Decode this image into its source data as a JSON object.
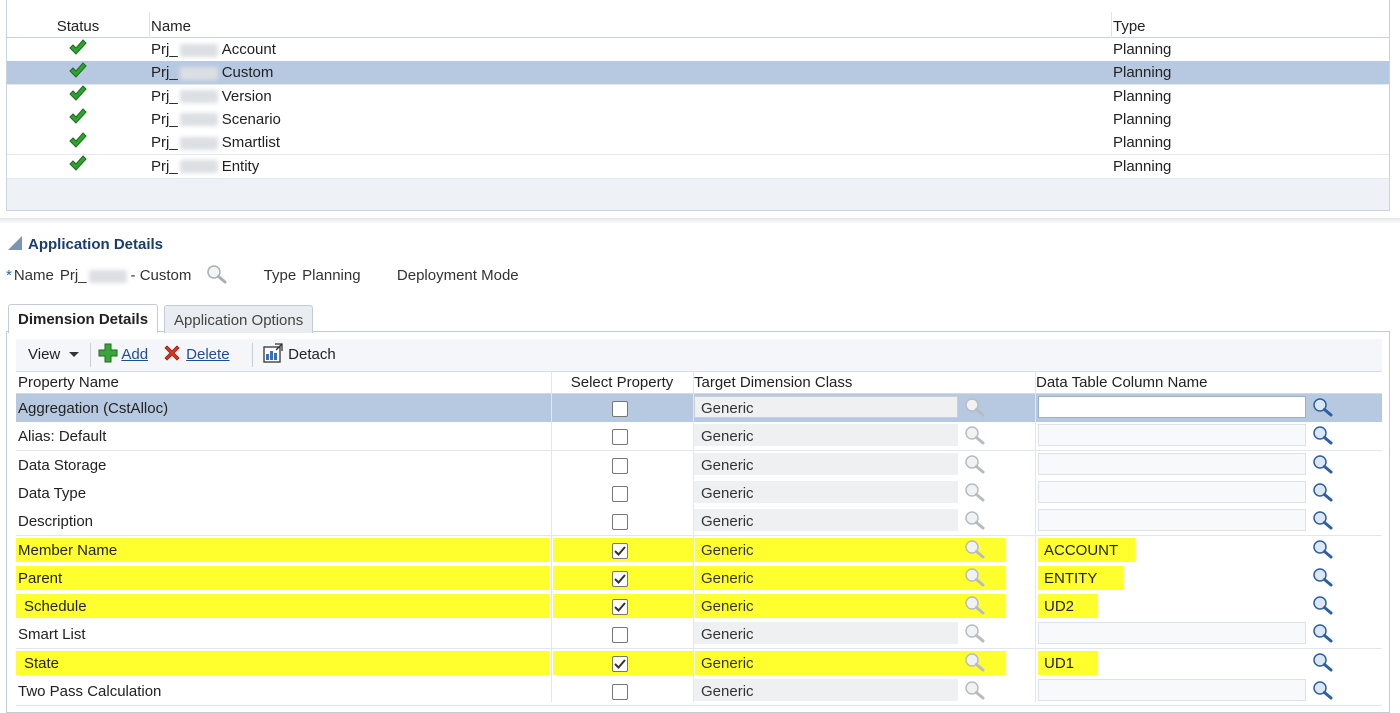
{
  "top_table": {
    "columns": [
      "Status",
      "Name",
      "Type"
    ],
    "rows": [
      {
        "prefix": "Prj_",
        "suffix": "Account",
        "type": "Planning",
        "selected": false
      },
      {
        "prefix": "Prj_",
        "suffix": "Custom",
        "type": "Planning",
        "selected": true
      },
      {
        "prefix": "Prj_",
        "suffix": "Version",
        "type": "Planning",
        "selected": false
      },
      {
        "prefix": "Prj_",
        "suffix": "Scenario",
        "type": "Planning",
        "selected": false
      },
      {
        "prefix": "Prj_",
        "suffix": "Smartlist",
        "type": "Planning",
        "selected": false
      },
      {
        "prefix": "Prj_",
        "suffix": "Entity",
        "type": "Planning",
        "selected": false
      }
    ]
  },
  "app_details": {
    "title": "Application Details",
    "required_mark": "*",
    "name_label": "Name",
    "name_prefix": "Prj_",
    "name_suffix": "- Custom",
    "type_label": "Type",
    "type_value": "Planning",
    "deployment_label": "Deployment Mode"
  },
  "tabs": [
    {
      "label": "Dimension Details",
      "active": true
    },
    {
      "label": "Application Options",
      "active": false
    }
  ],
  "toolbar": {
    "view_label": "View",
    "add_label": "Add",
    "delete_label": "Delete",
    "detach_label": "Detach"
  },
  "grid": {
    "columns": [
      "Property Name",
      "Select Property",
      "Target Dimension Class",
      "Data Table Column Name"
    ],
    "rows": [
      {
        "property": "Aggregation (CstAlloc)",
        "checked": false,
        "target": "Generic",
        "column": "",
        "selected": true,
        "highlight": false
      },
      {
        "property": "Alias: Default",
        "checked": false,
        "target": "Generic",
        "column": "",
        "selected": false,
        "highlight": false
      },
      {
        "property": "Data Storage",
        "checked": false,
        "target": "Generic",
        "column": "",
        "selected": false,
        "highlight": false
      },
      {
        "property": "Data Type",
        "checked": false,
        "target": "Generic",
        "column": "",
        "selected": false,
        "highlight": false
      },
      {
        "property": "Description",
        "checked": false,
        "target": "Generic",
        "column": "",
        "selected": false,
        "highlight": false
      },
      {
        "property": "Member Name",
        "checked": true,
        "target": "Generic",
        "column": "ACCOUNT",
        "selected": false,
        "highlight": true
      },
      {
        "property": "Parent",
        "checked": true,
        "target": "Generic",
        "column": "ENTITY",
        "selected": false,
        "highlight": true
      },
      {
        "property": "Schedule",
        "checked": true,
        "target": "Generic",
        "column": "UD2",
        "selected": false,
        "highlight": true
      },
      {
        "property": "Smart List",
        "checked": false,
        "target": "Generic",
        "column": "",
        "selected": false,
        "highlight": false
      },
      {
        "property": "State",
        "checked": true,
        "target": "Generic",
        "column": "UD1",
        "selected": false,
        "highlight": true
      },
      {
        "property": "Two Pass Calculation",
        "checked": false,
        "target": "Generic",
        "column": "",
        "selected": false,
        "highlight": false
      }
    ]
  },
  "colors": {
    "selection": "#b7c9e1",
    "highlight": "#ffff2e",
    "link": "#1d4e8f",
    "check_green": "#2fa32f"
  }
}
